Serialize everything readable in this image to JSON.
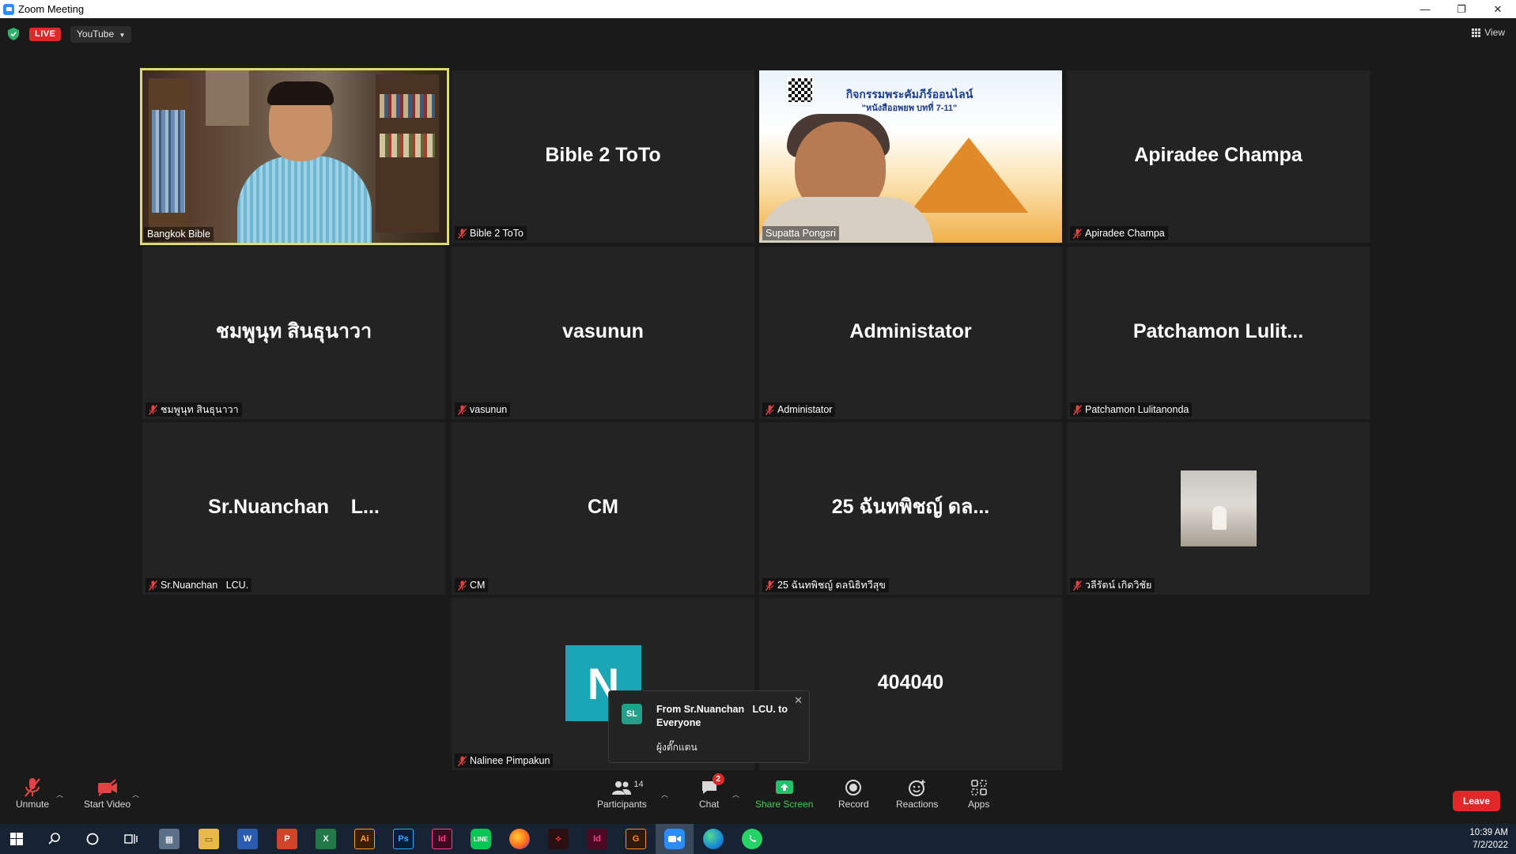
{
  "window": {
    "title": "Zoom Meeting",
    "controls": [
      "—",
      "❐",
      "✕"
    ]
  },
  "topbar": {
    "live": "LIVE",
    "stream": "YouTube",
    "view": "View"
  },
  "tiles": [
    {
      "name": "Bangkok Bible",
      "label": "Bangkok Bible",
      "video": true
    },
    {
      "name": "Bible 2 ToTo",
      "label": "Bible 2 ToTo"
    },
    {
      "name": "Supatta Pongsri",
      "label": "Supatta Pongsri",
      "video": true
    },
    {
      "name": "Apiradee Champa",
      "label": "Apiradee Champa"
    },
    {
      "name": "ชมพูนุท สินธุนาวา",
      "label": "ชมพูนุท สินธุนาวา"
    },
    {
      "name": "vasunun",
      "label": "vasunun"
    },
    {
      "name": "Administator",
      "label": "Administator"
    },
    {
      "name": "Patchamon  Lulit...",
      "label": "Patchamon Lulitanonda"
    },
    {
      "name": "Sr.Nuanchan    L...",
      "label": "Sr.Nuanchan   LCU."
    },
    {
      "name": "CM",
      "label": "CM"
    },
    {
      "name": "25 ฉันทพิชญ์ ดล...",
      "label": "25 ฉันทพิชญ์ ดลนิธิทวีสุข"
    },
    {
      "name": "วลีรัตน์ เกิดวิชัย",
      "label": "วลีรัตน์ เกิดวิชัย"
    },
    {
      "name": "Nalinee Pimpakun",
      "label": "Nalinee Pimpakun",
      "avatar": "N"
    },
    {
      "name": "404040",
      "label": ""
    }
  ],
  "poster": {
    "title": "กิจกรรมพระคัมภีร์ออนไลน์",
    "subtitle": "\"หนังสืออพยพ บทที่ 7-11\""
  },
  "chat_popup": {
    "avatar": "SL",
    "from": "From Sr.Nuanchan   LCU. to Everyone",
    "message": "ผู้งตั๊กแตน"
  },
  "toolbar": {
    "unmute": "Unmute",
    "start_video": "Start Video",
    "participants": "Participants",
    "participant_count": "14",
    "chat": "Chat",
    "chat_badge": "2",
    "share_screen": "Share Screen",
    "record": "Record",
    "reactions": "Reactions",
    "apps": "Apps",
    "leave": "Leave"
  },
  "taskbar": {
    "apps": [
      "search-icon",
      "cortana-icon",
      "task-view-icon",
      "calculator-icon",
      "file-explorer-icon",
      "word-icon",
      "powerpoint-icon",
      "excel-icon",
      "illustrator-icon",
      "photoshop-icon",
      "indesign-icon",
      "line-icon",
      "firefox-icon",
      "acrobat-icon",
      "indesign-dark-icon",
      "grammarly-icon",
      "zoom-icon",
      "edge-icon",
      "whatsapp-icon"
    ],
    "time": "10:39 AM",
    "date": "7/2/2022"
  },
  "colors": {
    "active_speaker_border": "#dcdc6a",
    "live": "#e02828",
    "share_green": "#3ccf4e",
    "avatar_n": "#1ba6b5"
  }
}
